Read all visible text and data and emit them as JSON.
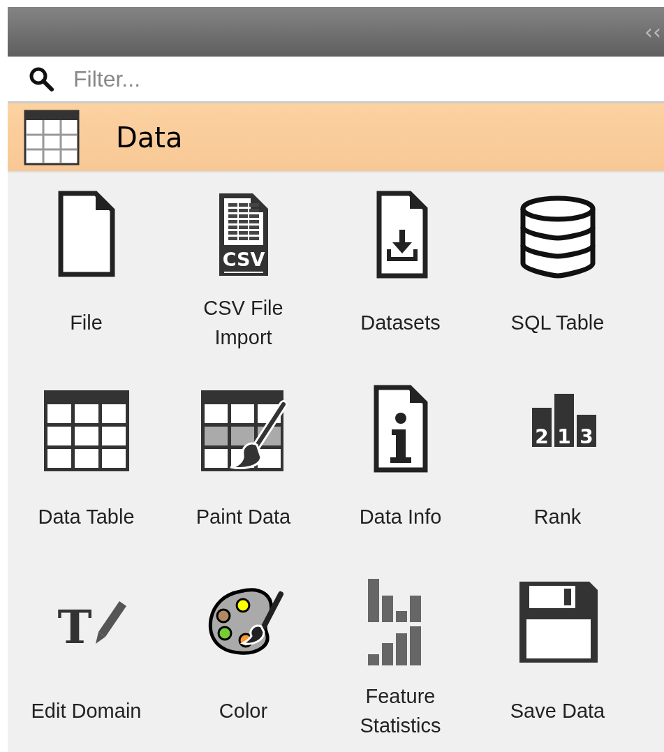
{
  "toolbar": {
    "collapse": "‹‹"
  },
  "search": {
    "placeholder": "Filter..."
  },
  "category": {
    "title": "Data",
    "expanded": true
  },
  "widgets": [
    {
      "label": "File"
    },
    {
      "label": "CSV File Import",
      "icon_text": [
        "CSV"
      ]
    },
    {
      "label": "Datasets"
    },
    {
      "label": "SQL Table"
    },
    {
      "label": "Data Table"
    },
    {
      "label": "Paint Data"
    },
    {
      "label": "Data Info"
    },
    {
      "label": "Rank",
      "icon_text": [
        "2",
        "1",
        "3"
      ]
    },
    {
      "label": "Edit Domain",
      "icon_text": [
        "T"
      ]
    },
    {
      "label": "Color"
    },
    {
      "label": "Feature Statistics"
    },
    {
      "label": "Save Data"
    }
  ]
}
